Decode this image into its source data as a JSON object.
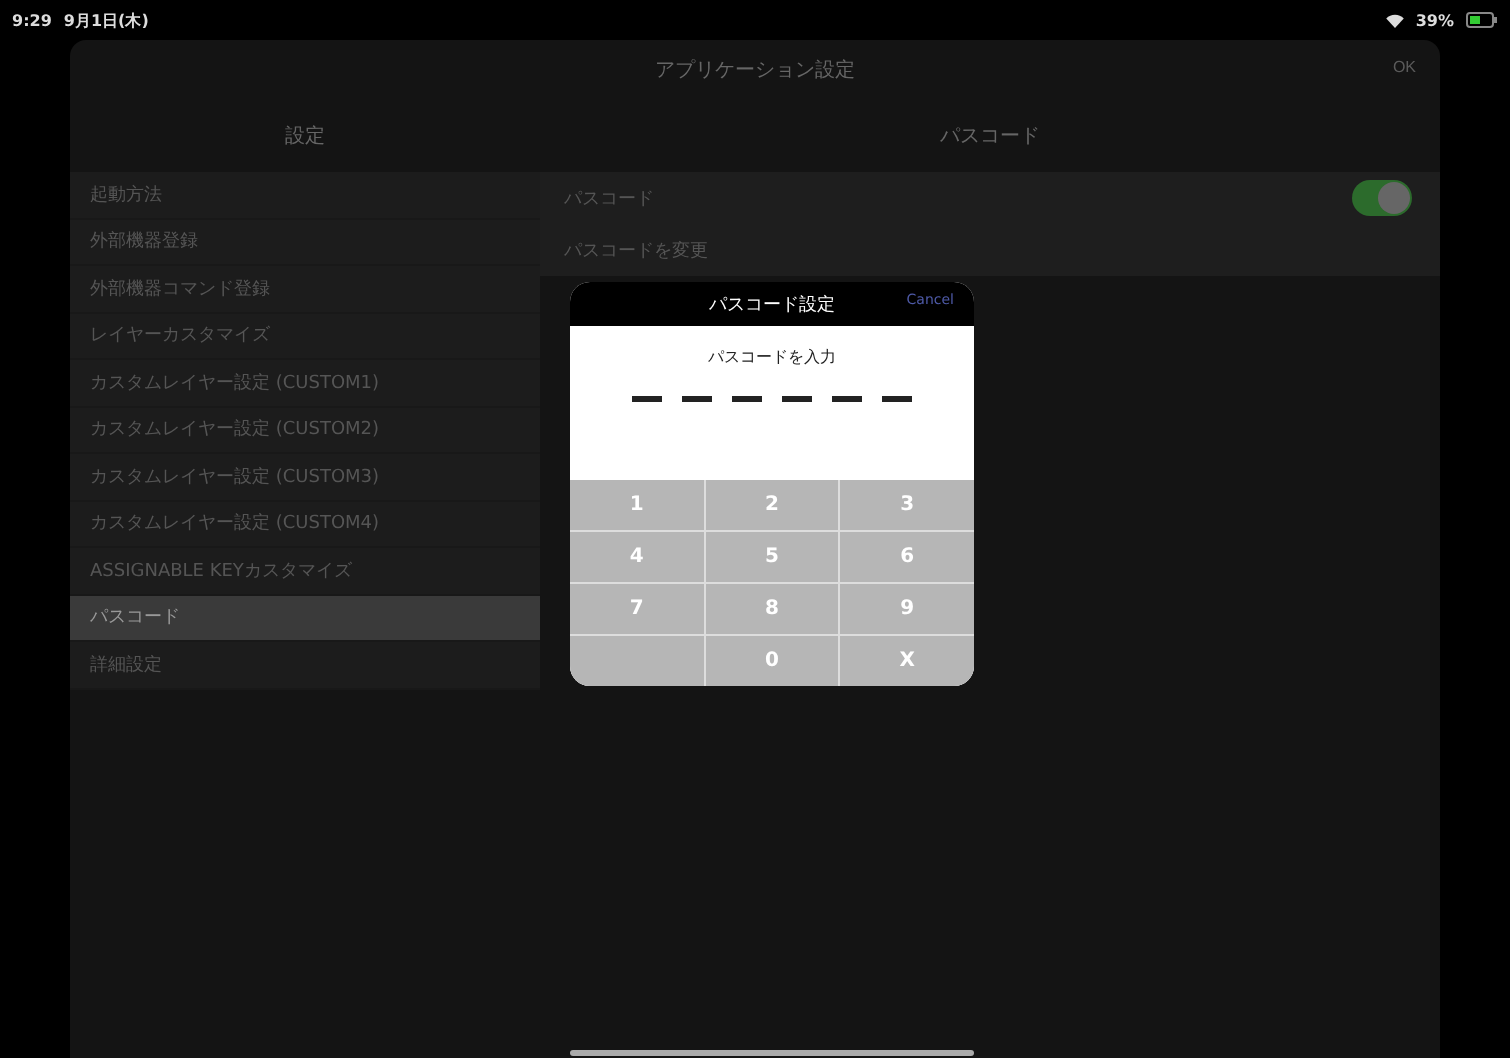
{
  "status_bar": {
    "time": "9:29",
    "date": "9月1日(木)",
    "battery": "39%"
  },
  "sheet": {
    "title": "アプリケーション設定",
    "ok_button": {
      "label": "OK",
      "disabled": true
    }
  },
  "sidebar": {
    "header": "設定",
    "items": [
      {
        "label": "起動方法",
        "selected": false
      },
      {
        "label": "外部機器登録",
        "selected": false
      },
      {
        "label": "外部機器コマンド登録",
        "selected": false
      },
      {
        "label": "レイヤーカスタマイズ",
        "selected": false
      },
      {
        "label": "カスタムレイヤー設定 (CUSTOM1)",
        "selected": false
      },
      {
        "label": "カスタムレイヤー設定 (CUSTOM2)",
        "selected": false
      },
      {
        "label": "カスタムレイヤー設定 (CUSTOM3)",
        "selected": false
      },
      {
        "label": "カスタムレイヤー設定 (CUSTOM4)",
        "selected": false
      },
      {
        "label": "ASSIGNABLE KEYカスタマイズ",
        "selected": false
      },
      {
        "label": "パスコード",
        "selected": true
      },
      {
        "label": "詳細設定",
        "selected": false
      }
    ]
  },
  "detail": {
    "header": "パスコード",
    "rows": [
      {
        "kind": "toggle",
        "label": "パスコード",
        "on": true
      },
      {
        "kind": "link",
        "label": "パスコードを変更"
      }
    ]
  },
  "passcode_dialog": {
    "title": "パスコード設定",
    "cancel": "Cancel",
    "prompt": "パスコードを入力",
    "keys": [
      "1",
      "2",
      "3",
      "4",
      "5",
      "6",
      "7",
      "8",
      "9",
      "0",
      "X"
    ]
  }
}
